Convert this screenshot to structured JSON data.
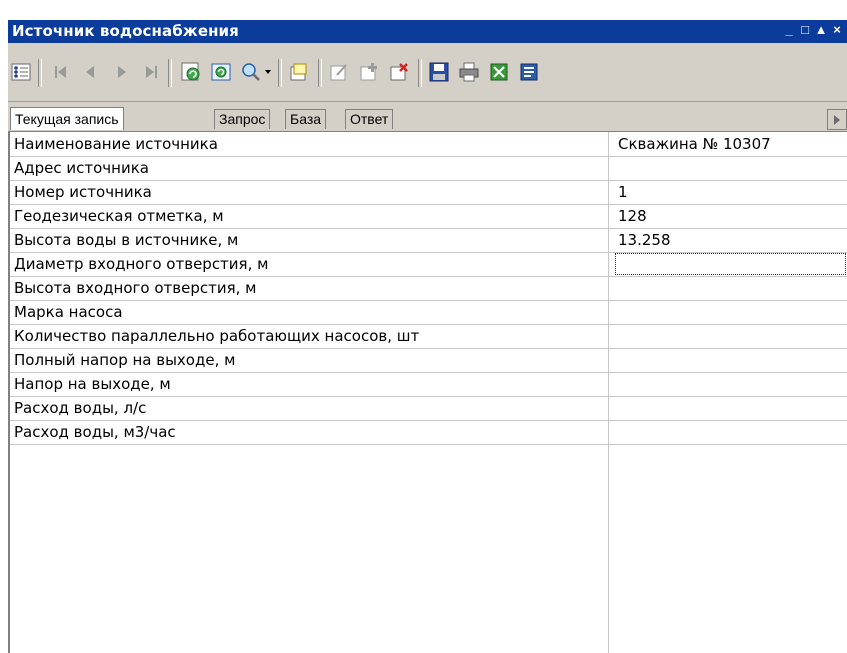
{
  "window": {
    "title": "Источник водоснабжения",
    "controls": {
      "minimize": "_",
      "maximize": "□",
      "up": "▲",
      "close": "×"
    }
  },
  "toolbar": {
    "buttons": [
      {
        "name": "row-selector-icon"
      },
      {
        "name": "first-record-icon"
      },
      {
        "name": "prev-record-icon"
      },
      {
        "name": "next-record-icon"
      },
      {
        "name": "last-record-icon"
      },
      {
        "name": "refresh-icon"
      },
      {
        "name": "reload-icon"
      },
      {
        "name": "search-dropdown-icon"
      },
      {
        "name": "new-record-icon"
      },
      {
        "name": "edit-record-icon"
      },
      {
        "name": "add-record-icon"
      },
      {
        "name": "delete-record-icon"
      },
      {
        "name": "save-icon"
      },
      {
        "name": "print-icon"
      },
      {
        "name": "export-excel-icon"
      },
      {
        "name": "export-word-icon"
      }
    ]
  },
  "tabs": [
    {
      "label": "Текущая запись",
      "active": true
    },
    {
      "label": "Запрос",
      "active": false
    },
    {
      "label": "База",
      "active": false
    },
    {
      "label": "Ответ",
      "active": false
    }
  ],
  "grid": {
    "rows": [
      {
        "name": "Наименование источника",
        "value": "Скважина № 10307"
      },
      {
        "name": "Адрес источника",
        "value": ""
      },
      {
        "name": "Номер источника",
        "value": "1"
      },
      {
        "name": "Геодезическая отметка, м",
        "value": "128"
      },
      {
        "name": "Высота воды в источнике, м",
        "value": "13.258"
      },
      {
        "name": "Диаметр входного отверстия, м",
        "value": ""
      },
      {
        "name": "Высота входного отверстия, м",
        "value": ""
      },
      {
        "name": "Марка насоса",
        "value": ""
      },
      {
        "name": "Количество параллельно работающих насосов, шт",
        "value": ""
      },
      {
        "name": "Полный напор на выходе, м",
        "value": ""
      },
      {
        "name": "Напор на выходе, м",
        "value": ""
      },
      {
        "name": "Расход воды, л/с",
        "value": ""
      },
      {
        "name": "Расход воды, м3/час",
        "value": ""
      }
    ]
  },
  "colors": {
    "titlebar": "#0b3c9c",
    "face": "#d4d0c8",
    "grid_line": "#c8c8c8"
  }
}
